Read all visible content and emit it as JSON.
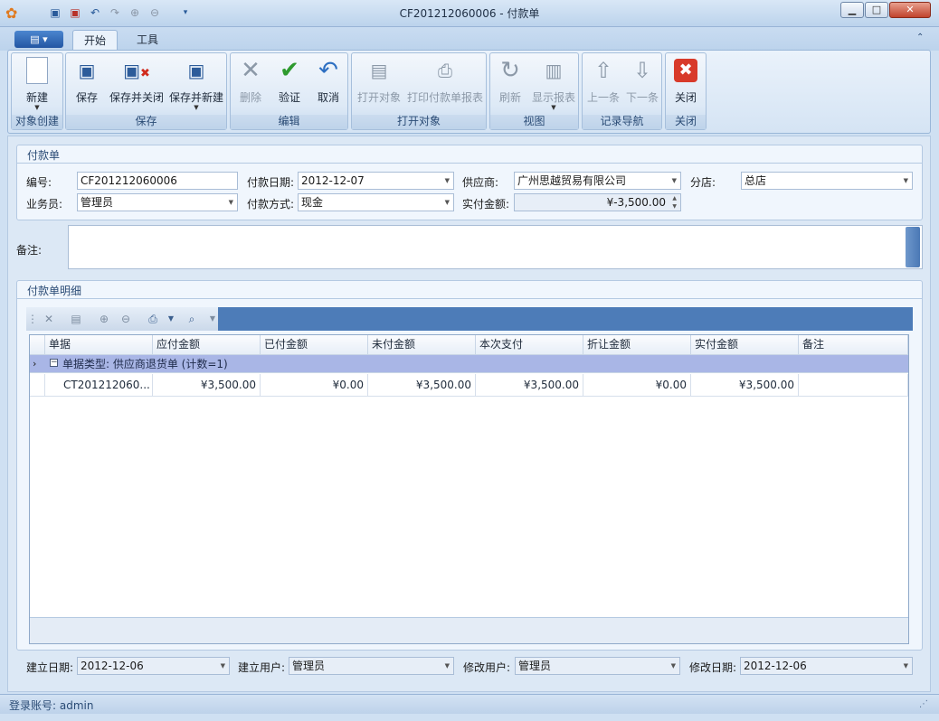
{
  "window": {
    "title": "CF201212060006 - 付款单",
    "min": "▁",
    "max": "□",
    "close": "✕"
  },
  "quick_access": [
    "save-icon",
    "save-close-icon",
    "undo-icon",
    "redo-icon",
    "up-icon",
    "down-icon",
    "customize-icon"
  ],
  "ribbon": {
    "tabs": [
      "开始",
      "工具"
    ],
    "groups": [
      {
        "label": "对象创建",
        "buttons": [
          {
            "label": "新建",
            "icon": "new-doc-icon",
            "disabled": false,
            "dropdown": true
          }
        ]
      },
      {
        "label": "保存",
        "buttons": [
          {
            "label": "保存",
            "icon": "save-icon"
          },
          {
            "label": "保存并关闭",
            "icon": "save-close-icon"
          },
          {
            "label": "保存并新建",
            "icon": "save-new-icon",
            "dropdown": true
          }
        ]
      },
      {
        "label": "编辑",
        "buttons": [
          {
            "label": "删除",
            "icon": "delete-icon",
            "disabled": true
          },
          {
            "label": "验证",
            "icon": "check-icon"
          },
          {
            "label": "取消",
            "icon": "undo-icon"
          }
        ]
      },
      {
        "label": "打开对象",
        "buttons": [
          {
            "label": "打开对象",
            "icon": "open-object-icon",
            "disabled": true
          },
          {
            "label": "打印付款单报表",
            "icon": "printer-icon",
            "disabled": true
          }
        ]
      },
      {
        "label": "视图",
        "buttons": [
          {
            "label": "刷新",
            "icon": "refresh-icon",
            "disabled": true
          },
          {
            "label": "显示报表",
            "icon": "clipboard-icon",
            "disabled": true,
            "dropdown": true
          }
        ]
      },
      {
        "label": "记录导航",
        "buttons": [
          {
            "label": "上一条",
            "icon": "up-circle-icon",
            "disabled": true
          },
          {
            "label": "下一条",
            "icon": "down-circle-icon",
            "disabled": true
          }
        ]
      },
      {
        "label": "关闭",
        "buttons": [
          {
            "label": "关闭",
            "icon": "close-red-icon"
          }
        ]
      }
    ]
  },
  "form": {
    "section_title": "付款单",
    "number_label": "编号:",
    "number": "CF201212060006",
    "date_label": "付款日期:",
    "date": "2012-12-07",
    "supplier_label": "供应商:",
    "supplier": "广州思越贸易有限公司",
    "branch_label": "分店:",
    "branch": "总店",
    "salesman_label": "业务员:",
    "salesman": "管理员",
    "method_label": "付款方式:",
    "method": "现金",
    "actual_label": "实付金额:",
    "actual": "¥-3,500.00",
    "remark_label": "备注:",
    "remark": ""
  },
  "detail": {
    "section_title": "付款单明细",
    "columns": [
      "单据",
      "应付金额",
      "已付金额",
      "未付金额",
      "本次支付",
      "折让金额",
      "实付金额",
      "备注"
    ],
    "group_label": "单据类型: 供应商退货单 (计数=1)",
    "rows": [
      [
        "CT201212060...",
        "¥3,500.00",
        "¥0.00",
        "¥3,500.00",
        "¥3,500.00",
        "¥0.00",
        "¥3,500.00",
        ""
      ]
    ]
  },
  "footer": {
    "created_date_label": "建立日期:",
    "created_date": "2012-12-06",
    "created_user_label": "建立用户:",
    "created_user": "管理员",
    "modified_user_label": "修改用户:",
    "modified_user": "管理员",
    "modified_date_label": "修改日期:",
    "modified_date": "2012-12-06"
  },
  "status": {
    "text": "登录账号: admin"
  }
}
